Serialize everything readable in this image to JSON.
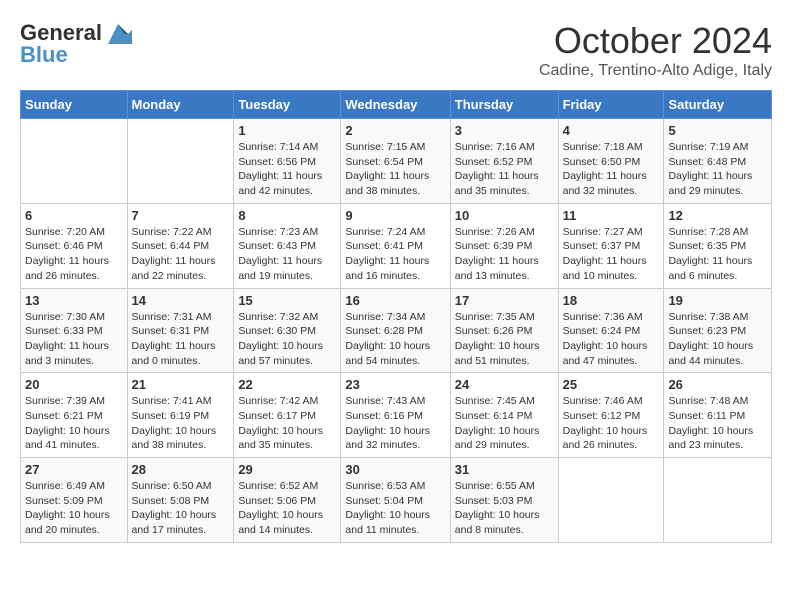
{
  "header": {
    "logo_general": "General",
    "logo_blue": "Blue",
    "month_title": "October 2024",
    "subtitle": "Cadine, Trentino-Alto Adige, Italy"
  },
  "days_of_week": [
    "Sunday",
    "Monday",
    "Tuesday",
    "Wednesday",
    "Thursday",
    "Friday",
    "Saturday"
  ],
  "weeks": [
    [
      {
        "day": "",
        "info": ""
      },
      {
        "day": "",
        "info": ""
      },
      {
        "day": "1",
        "info": "Sunrise: 7:14 AM\nSunset: 6:56 PM\nDaylight: 11 hours and 42 minutes."
      },
      {
        "day": "2",
        "info": "Sunrise: 7:15 AM\nSunset: 6:54 PM\nDaylight: 11 hours and 38 minutes."
      },
      {
        "day": "3",
        "info": "Sunrise: 7:16 AM\nSunset: 6:52 PM\nDaylight: 11 hours and 35 minutes."
      },
      {
        "day": "4",
        "info": "Sunrise: 7:18 AM\nSunset: 6:50 PM\nDaylight: 11 hours and 32 minutes."
      },
      {
        "day": "5",
        "info": "Sunrise: 7:19 AM\nSunset: 6:48 PM\nDaylight: 11 hours and 29 minutes."
      }
    ],
    [
      {
        "day": "6",
        "info": "Sunrise: 7:20 AM\nSunset: 6:46 PM\nDaylight: 11 hours and 26 minutes."
      },
      {
        "day": "7",
        "info": "Sunrise: 7:22 AM\nSunset: 6:44 PM\nDaylight: 11 hours and 22 minutes."
      },
      {
        "day": "8",
        "info": "Sunrise: 7:23 AM\nSunset: 6:43 PM\nDaylight: 11 hours and 19 minutes."
      },
      {
        "day": "9",
        "info": "Sunrise: 7:24 AM\nSunset: 6:41 PM\nDaylight: 11 hours and 16 minutes."
      },
      {
        "day": "10",
        "info": "Sunrise: 7:26 AM\nSunset: 6:39 PM\nDaylight: 11 hours and 13 minutes."
      },
      {
        "day": "11",
        "info": "Sunrise: 7:27 AM\nSunset: 6:37 PM\nDaylight: 11 hours and 10 minutes."
      },
      {
        "day": "12",
        "info": "Sunrise: 7:28 AM\nSunset: 6:35 PM\nDaylight: 11 hours and 6 minutes."
      }
    ],
    [
      {
        "day": "13",
        "info": "Sunrise: 7:30 AM\nSunset: 6:33 PM\nDaylight: 11 hours and 3 minutes."
      },
      {
        "day": "14",
        "info": "Sunrise: 7:31 AM\nSunset: 6:31 PM\nDaylight: 11 hours and 0 minutes."
      },
      {
        "day": "15",
        "info": "Sunrise: 7:32 AM\nSunset: 6:30 PM\nDaylight: 10 hours and 57 minutes."
      },
      {
        "day": "16",
        "info": "Sunrise: 7:34 AM\nSunset: 6:28 PM\nDaylight: 10 hours and 54 minutes."
      },
      {
        "day": "17",
        "info": "Sunrise: 7:35 AM\nSunset: 6:26 PM\nDaylight: 10 hours and 51 minutes."
      },
      {
        "day": "18",
        "info": "Sunrise: 7:36 AM\nSunset: 6:24 PM\nDaylight: 10 hours and 47 minutes."
      },
      {
        "day": "19",
        "info": "Sunrise: 7:38 AM\nSunset: 6:23 PM\nDaylight: 10 hours and 44 minutes."
      }
    ],
    [
      {
        "day": "20",
        "info": "Sunrise: 7:39 AM\nSunset: 6:21 PM\nDaylight: 10 hours and 41 minutes."
      },
      {
        "day": "21",
        "info": "Sunrise: 7:41 AM\nSunset: 6:19 PM\nDaylight: 10 hours and 38 minutes."
      },
      {
        "day": "22",
        "info": "Sunrise: 7:42 AM\nSunset: 6:17 PM\nDaylight: 10 hours and 35 minutes."
      },
      {
        "day": "23",
        "info": "Sunrise: 7:43 AM\nSunset: 6:16 PM\nDaylight: 10 hours and 32 minutes."
      },
      {
        "day": "24",
        "info": "Sunrise: 7:45 AM\nSunset: 6:14 PM\nDaylight: 10 hours and 29 minutes."
      },
      {
        "day": "25",
        "info": "Sunrise: 7:46 AM\nSunset: 6:12 PM\nDaylight: 10 hours and 26 minutes."
      },
      {
        "day": "26",
        "info": "Sunrise: 7:48 AM\nSunset: 6:11 PM\nDaylight: 10 hours and 23 minutes."
      }
    ],
    [
      {
        "day": "27",
        "info": "Sunrise: 6:49 AM\nSunset: 5:09 PM\nDaylight: 10 hours and 20 minutes."
      },
      {
        "day": "28",
        "info": "Sunrise: 6:50 AM\nSunset: 5:08 PM\nDaylight: 10 hours and 17 minutes."
      },
      {
        "day": "29",
        "info": "Sunrise: 6:52 AM\nSunset: 5:06 PM\nDaylight: 10 hours and 14 minutes."
      },
      {
        "day": "30",
        "info": "Sunrise: 6:53 AM\nSunset: 5:04 PM\nDaylight: 10 hours and 11 minutes."
      },
      {
        "day": "31",
        "info": "Sunrise: 6:55 AM\nSunset: 5:03 PM\nDaylight: 10 hours and 8 minutes."
      },
      {
        "day": "",
        "info": ""
      },
      {
        "day": "",
        "info": ""
      }
    ]
  ]
}
